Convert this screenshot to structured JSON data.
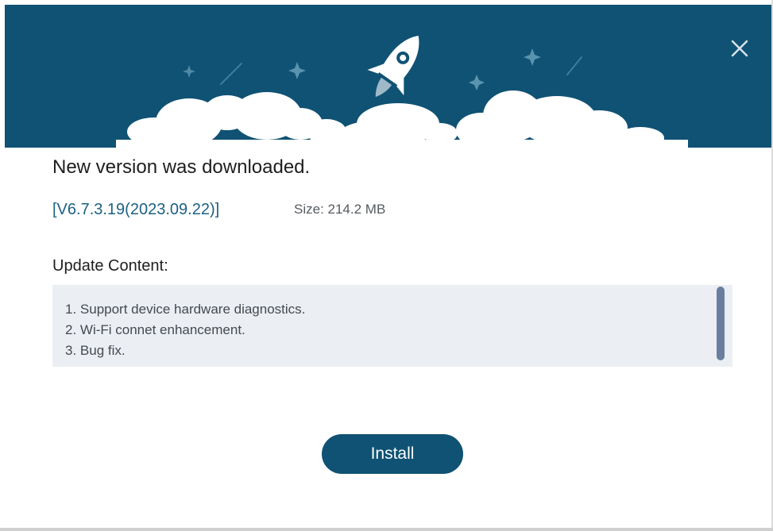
{
  "dialog": {
    "title": "New version was downloaded.",
    "version": "[V6.7.3.19(2023.09.22)]",
    "size": "Size: 214.2 MB",
    "update_content_label": "Update Content:",
    "update_items": [
      "1. Support device hardware diagnostics.",
      "2. Wi-Fi connet enhancement.",
      "3. Bug fix."
    ],
    "install_label": "Install"
  },
  "icons": {
    "close": "close-icon",
    "rocket": "rocket-icon",
    "stars": "sparkle-icon",
    "clouds": "cloud-decoration"
  },
  "colors": {
    "header_bg": "#0f5274",
    "accent": "#0f5274",
    "version_text": "#1c6184",
    "content_bg": "#ebeef2",
    "scrollbar": "#6a7fa0"
  }
}
